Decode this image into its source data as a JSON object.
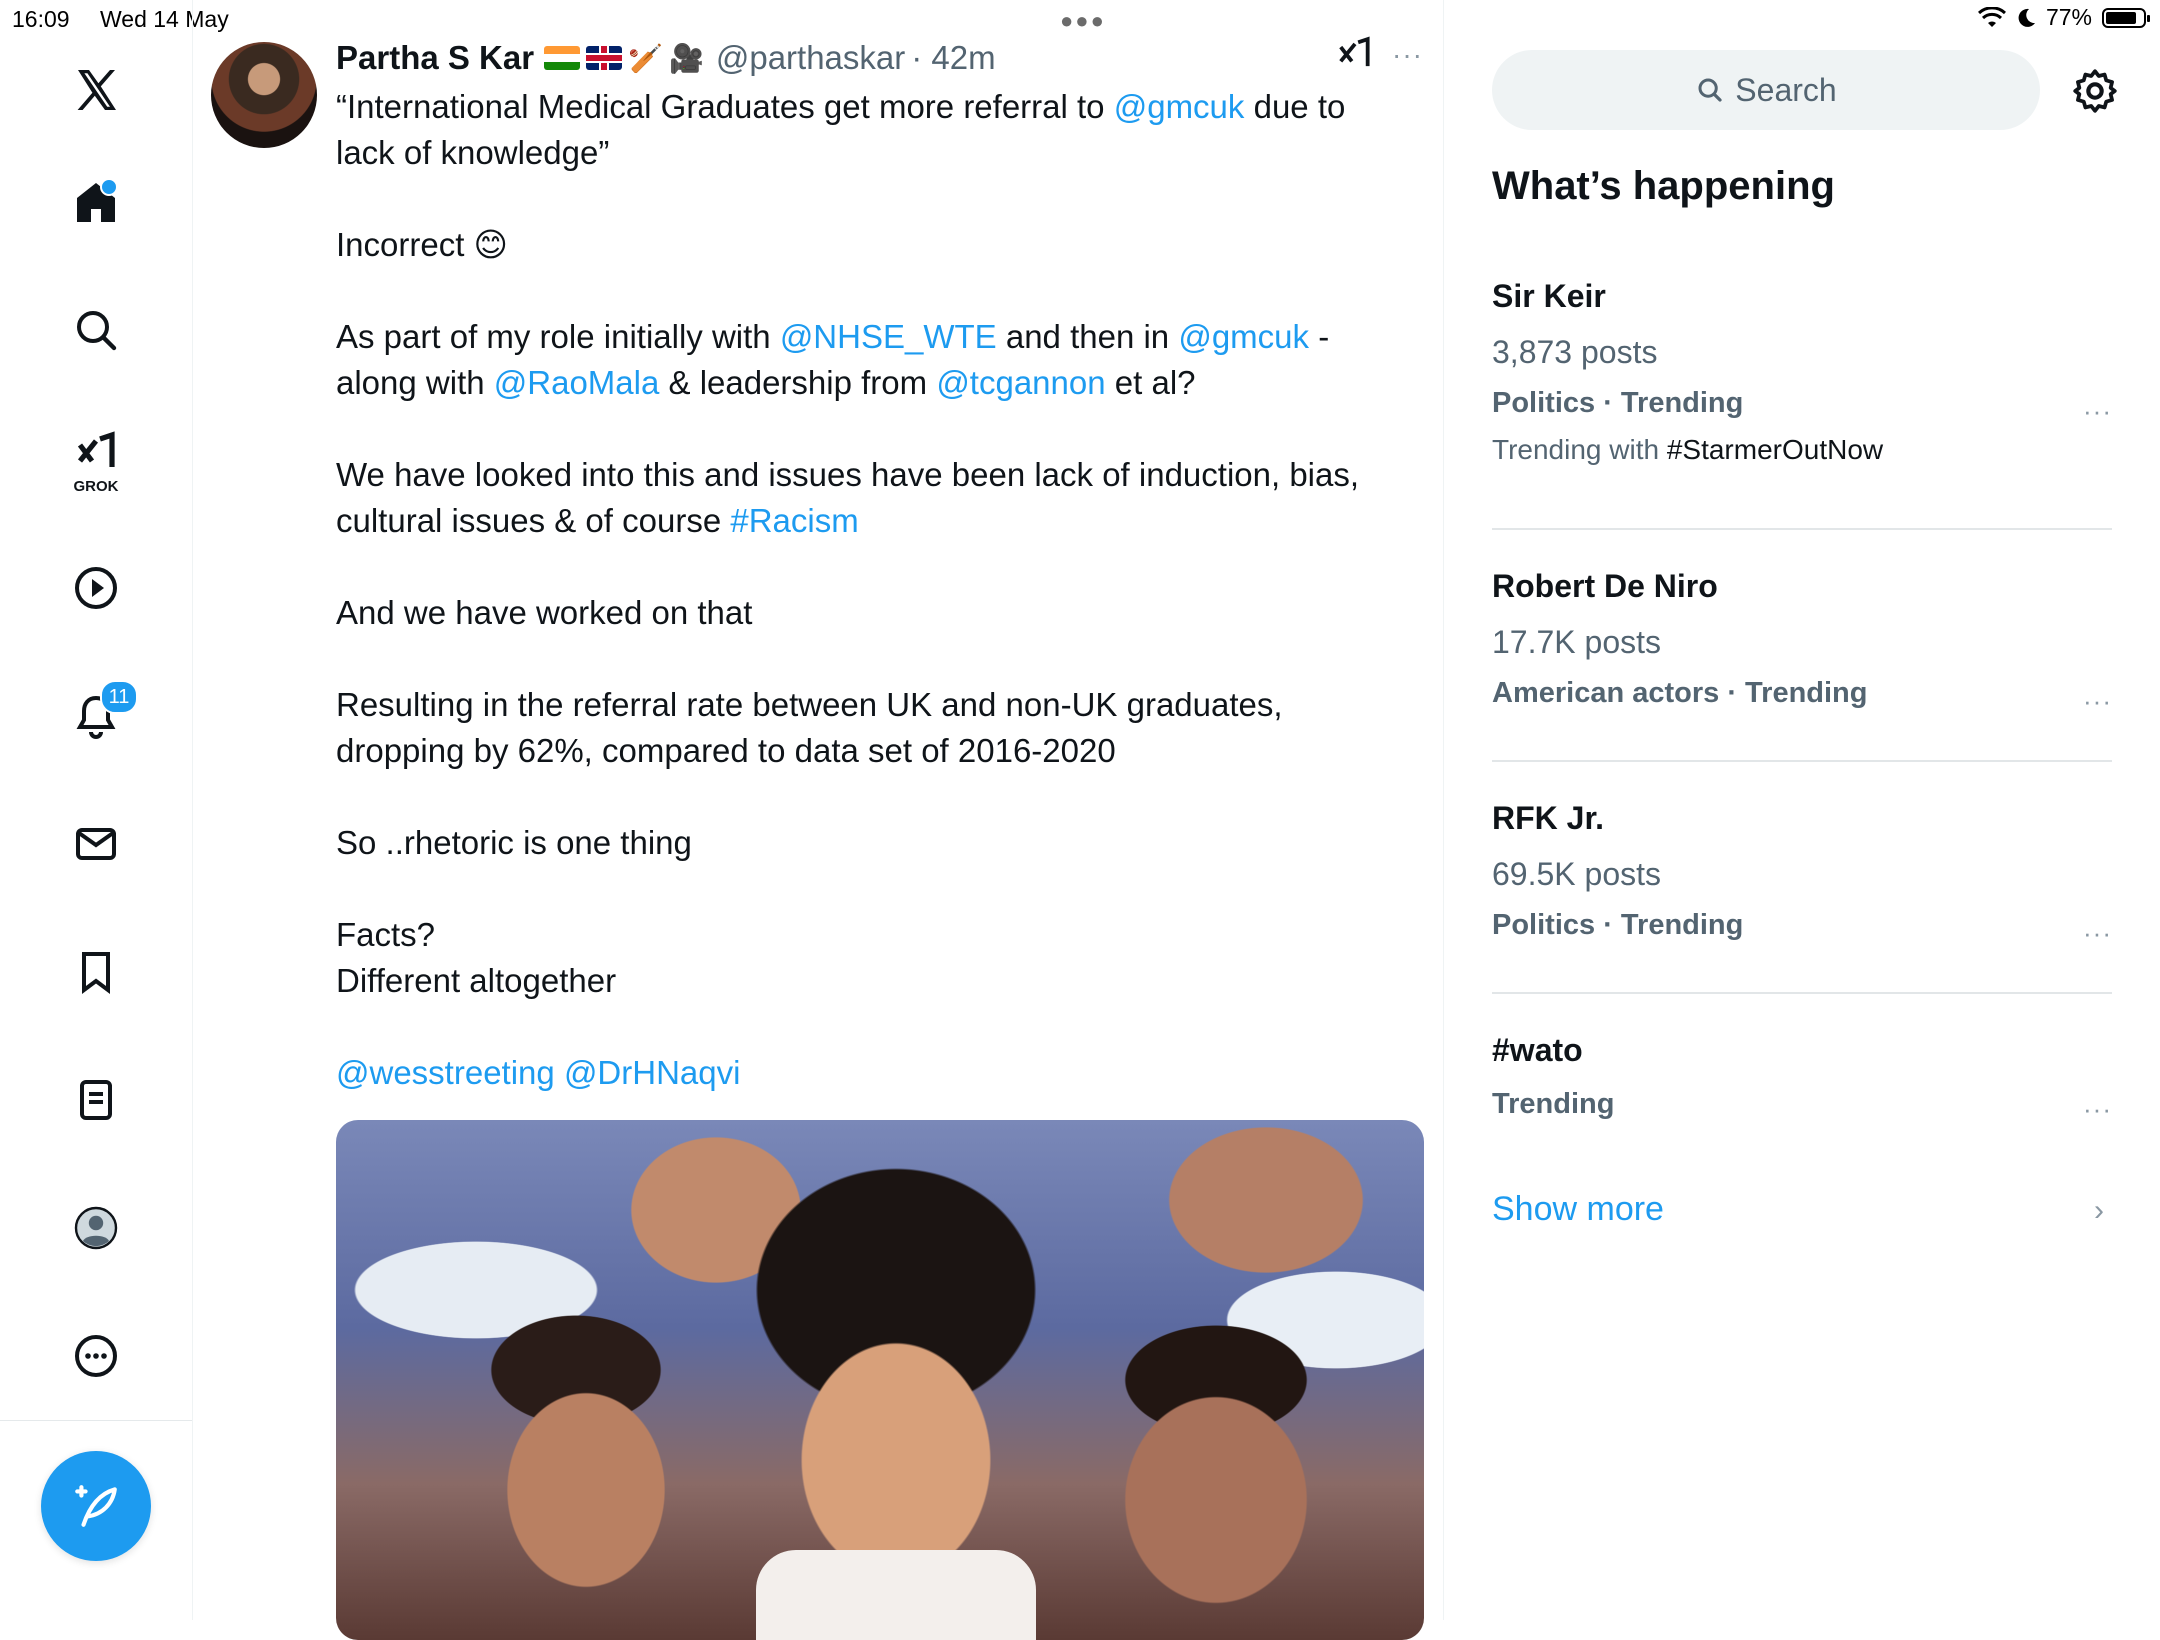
{
  "status_bar": {
    "time": "16:09",
    "date": "Wed 14 May",
    "battery": "77%"
  },
  "nav": {
    "notifications_count": "11",
    "grok_label": "GROK"
  },
  "tweet": {
    "name": "Partha S Kar",
    "handle": "@parthaskar",
    "time": "· 42m",
    "more": "···"
  },
  "tweet_body": {
    "p1": {
      "a": "“International Medical Graduates get more referral to ",
      "b": "@gmcuk",
      "c": " due to lack of knowledge”"
    },
    "p2": {
      "a": "Incorrect ",
      "emoji": "😊"
    },
    "p3": {
      "a": "As part of my role initially with ",
      "b": "@NHSE_WTE",
      "c": " and then in ",
      "d": "@gmcuk",
      "e": " - along with ",
      "f": "@RaoMala",
      "g": " & leadership from ",
      "h": "@tcgannon",
      "i": " et al?"
    },
    "p4": {
      "a": "We have looked into this and issues have been lack of induction, bias, cultural issues & of course ",
      "b": "#Racism"
    },
    "p5": {
      "a": "And we have worked on that"
    },
    "p6": {
      "a": "Resulting in the referral rate between UK and non-UK graduates, dropping by 62%, compared to data set of 2016-2020"
    },
    "p7": {
      "a": "So ..rhetoric is one thing"
    },
    "p8": {
      "a": "Facts?",
      "b": "Different altogether"
    },
    "p9": {
      "a": "@wesstreeting",
      "b": "@DrHNaqvi"
    }
  },
  "search": {
    "label": "Search"
  },
  "sidebar": {
    "title": "What’s happening",
    "trends": [
      {
        "title": "Sir Keir",
        "posts": "3,873 posts",
        "category": "Politics · Trending",
        "with_prefix": "Trending with ",
        "with_tag": "#StarmerOutNow"
      },
      {
        "title": "Robert De Niro",
        "posts": "17.7K posts",
        "category": "American actors · Trending"
      },
      {
        "title": "RFK Jr.",
        "posts": "69.5K posts",
        "category": "Politics · Trending"
      },
      {
        "title": "#wato",
        "category": "Trending"
      }
    ],
    "more": "···",
    "show_more": "Show more"
  },
  "colors": {
    "accent": "#1d9bf0",
    "text": "#0f1419",
    "secondary": "#536471"
  }
}
